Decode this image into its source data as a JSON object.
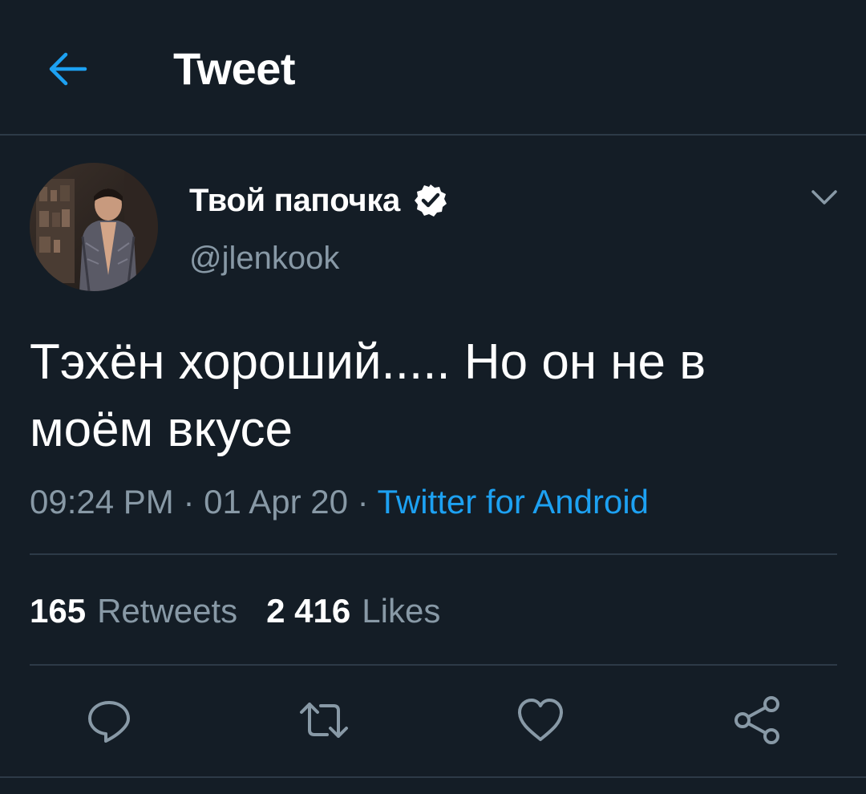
{
  "header": {
    "title": "Tweet",
    "back_icon": "arrow-left-icon"
  },
  "colors": {
    "background": "#141d26",
    "accent": "#1da1f2",
    "secondary_text": "#8899a6",
    "divider": "#2d3a47"
  },
  "tweet": {
    "display_name": "Твой папочка",
    "verified": true,
    "handle": "@jlenkook",
    "text": "Тэхён хороший..... Но он не в моём вкусе",
    "time": "09:24 PM",
    "separator": "·",
    "date": "01 Apr 20",
    "source": "Twitter for Android",
    "stats": {
      "retweets_count": "165",
      "retweets_label": "Retweets",
      "likes_count": "2 416",
      "likes_label": "Likes"
    },
    "actions": [
      "reply-icon",
      "retweet-icon",
      "like-icon",
      "share-icon"
    ]
  }
}
